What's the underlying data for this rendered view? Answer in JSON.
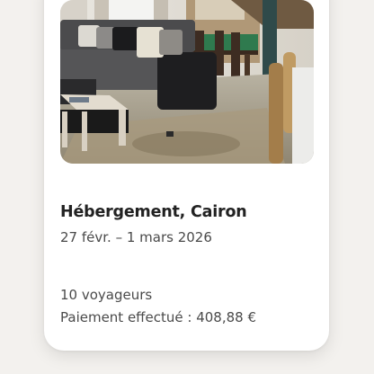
{
  "booking": {
    "title": "Hébergement, Cairon",
    "dates": "27 févr. – 1 mars 2026",
    "guests": "10 voyageurs",
    "payment": "Paiement effectué : 408,88 €"
  },
  "photo": {
    "subject": "living-room-photo"
  },
  "colors": {
    "background": "#f3f1ee",
    "card": "#ffffff",
    "title": "#222222",
    "secondary_text": "#4a4a4a"
  }
}
